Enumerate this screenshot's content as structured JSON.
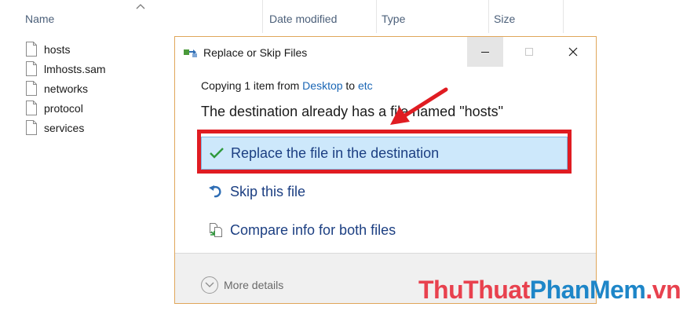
{
  "explorer": {
    "columns": {
      "name": "Name",
      "date_modified": "Date modified",
      "type": "Type",
      "size": "Size"
    },
    "files": [
      {
        "name": "hosts"
      },
      {
        "name": "lmhosts.sam"
      },
      {
        "name": "networks"
      },
      {
        "name": "protocol"
      },
      {
        "name": "services"
      }
    ]
  },
  "dialog": {
    "title": "Replace or Skip Files",
    "copying": {
      "prefix": "Copying 1 item from ",
      "source": "Desktop",
      "middle": " to ",
      "destination": "etc"
    },
    "message": "The destination already has a file named \"hosts\"",
    "options": {
      "replace": "Replace the file in the destination",
      "skip": "Skip this file",
      "compare": "Compare info for both files"
    },
    "more_details": "More details"
  },
  "watermark": {
    "part1": "ThuThuat",
    "part2": "PhanMem",
    "part3": ".vn"
  },
  "colors": {
    "highlight_border": "#e01c22",
    "selected_option_bg": "#cde8fb",
    "option_text": "#1c3f82",
    "link": "#1a66b5",
    "dialog_border": "#e0a65a"
  }
}
